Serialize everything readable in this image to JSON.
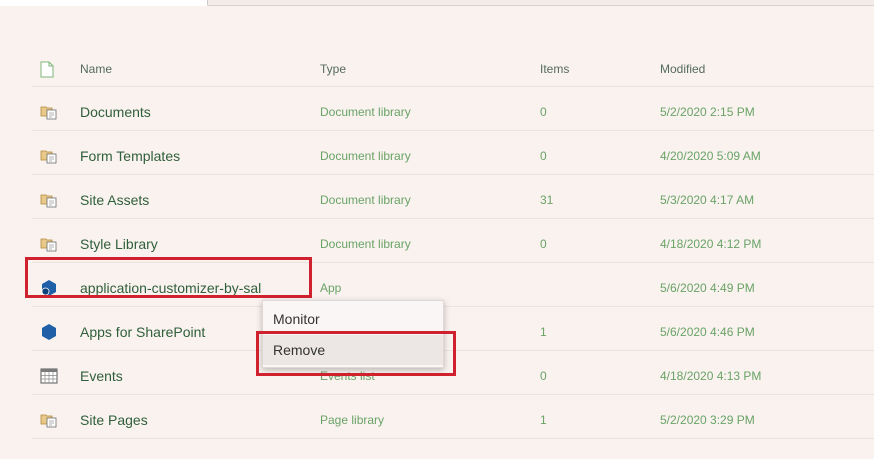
{
  "columns": {
    "icon": "file-icon",
    "name": "Name",
    "type": "Type",
    "items": "Items",
    "modified": "Modified"
  },
  "rows": [
    {
      "icon": "document-library-icon",
      "name": "Documents",
      "type": "Document library",
      "items": "0",
      "modified": "5/2/2020 2:15 PM"
    },
    {
      "icon": "document-library-icon",
      "name": "Form Templates",
      "type": "Document library",
      "items": "0",
      "modified": "4/20/2020 5:09 AM"
    },
    {
      "icon": "document-library-icon",
      "name": "Site Assets",
      "type": "Document library",
      "items": "31",
      "modified": "5/3/2020 4:17 AM"
    },
    {
      "icon": "document-library-icon",
      "name": "Style Library",
      "type": "Document library",
      "items": "0",
      "modified": "4/18/2020 4:12 PM"
    },
    {
      "icon": "app-icon",
      "name": "application-customizer-by-sal",
      "type": "App",
      "items": "",
      "modified": "5/6/2020 4:49 PM"
    },
    {
      "icon": "app-icon",
      "name": "Apps for SharePoint",
      "type": "",
      "items": "1",
      "modified": "5/6/2020 4:46 PM"
    },
    {
      "icon": "calendar-icon",
      "name": "Events",
      "type": "Events list",
      "items": "0",
      "modified": "4/18/2020 4:13 PM"
    },
    {
      "icon": "document-library-icon",
      "name": "Site Pages",
      "type": "Page library",
      "items": "1",
      "modified": "5/2/2020 3:29 PM"
    }
  ],
  "context_menu": {
    "items": [
      "Monitor",
      "Remove"
    ]
  },
  "colors": {
    "highlight": "#d0222e",
    "text_green": "#6aa366",
    "name_green": "#2f5f3a",
    "app_blue": "#1f5fa8"
  }
}
